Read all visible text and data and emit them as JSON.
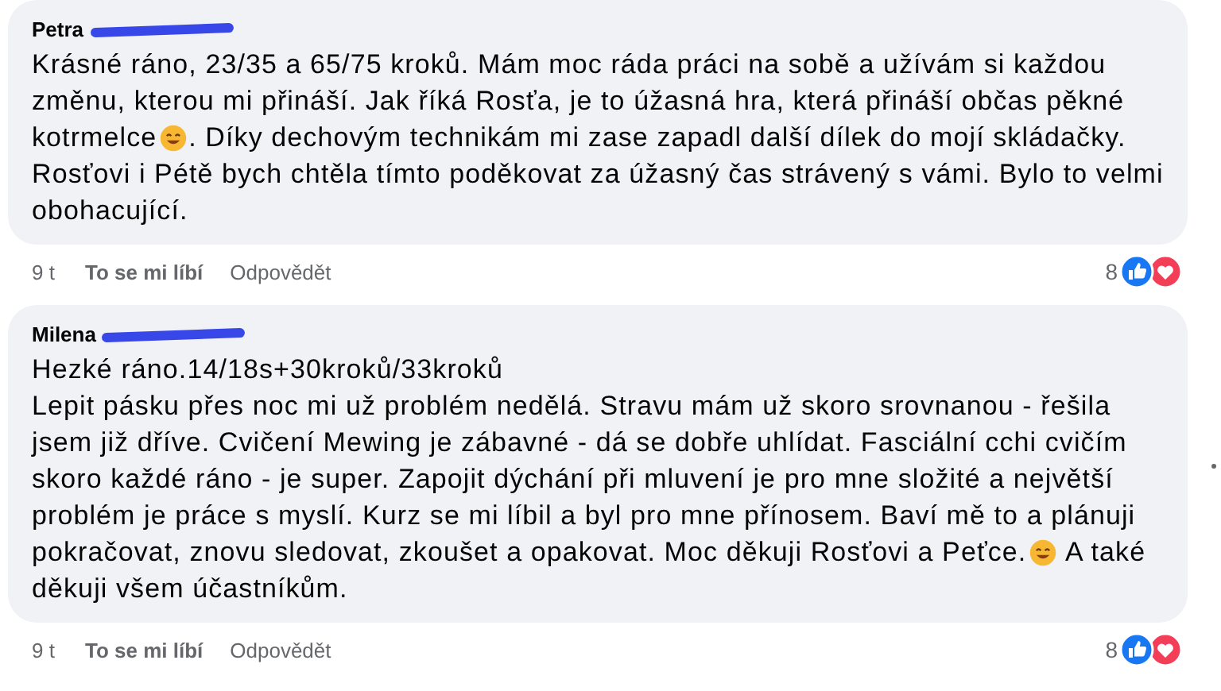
{
  "comments": [
    {
      "author": "Petra",
      "author_redacted": true,
      "lines": [
        [
          {
            "kind": "text",
            "text": "Krásné ráno, 23/35 a 65/75 kroků. Mám moc ráda práci na sobě a užívám si každou"
          }
        ],
        [
          {
            "kind": "text",
            "text": "změnu, kterou mi přináší. Jak říká Rosťa, je to úžasná hra, která přináší občas pěkné"
          }
        ],
        [
          {
            "kind": "text",
            "text": "kotrmelce"
          },
          {
            "kind": "emoji"
          },
          {
            "kind": "text",
            "text": ". Díky dechovým technikám mi zase zapadl další dílek do mojí skládačky."
          }
        ],
        [
          {
            "kind": "text",
            "text": "Rosťovi i Pétě bych chtěla tímto poděkovat za úžasný čas strávený s vámi. Bylo to velmi"
          }
        ],
        [
          {
            "kind": "text",
            "text": "obohacující."
          }
        ]
      ],
      "time": "9 t",
      "like": "To se mi líbí",
      "reply": "Odpovědět",
      "reaction_count": "8",
      "more": false
    },
    {
      "author": "Milena",
      "author_redacted": true,
      "lines": [
        [
          {
            "kind": "text",
            "text": "Hezké ráno.14/18s+30kroků/33kroků"
          }
        ],
        [
          {
            "kind": "text",
            "text": "Lepit pásku přes noc mi už problém nedělá. Stravu mám už skoro srovnanou - řešila"
          }
        ],
        [
          {
            "kind": "text",
            "text": "jsem již dříve. Cvičení Mewing je zábavné - dá se dobře uhlídat. Fasciální cchi cvičím"
          }
        ],
        [
          {
            "kind": "text",
            "text": "skoro každé ráno - je super. Zapojit dýchání při mluvení je pro mne složité a největší"
          }
        ],
        [
          {
            "kind": "text",
            "text": "problém je práce s myslí. Kurz se mi líbil a byl pro mne přínosem. Baví mě to a plánuji"
          }
        ],
        [
          {
            "kind": "text",
            "text": "pokračovat, znovu sledovat, zkoušet a opakovat. Moc děkuji Rosťovi a Peťce."
          },
          {
            "kind": "emoji"
          },
          {
            "kind": "text",
            "text": " A také"
          }
        ],
        [
          {
            "kind": "text",
            "text": "děkuji všem účastníkům."
          }
        ]
      ],
      "time": "9 t",
      "like": "To se mi líbí",
      "reply": "Odpovědět",
      "reaction_count": "8",
      "more": true
    }
  ]
}
